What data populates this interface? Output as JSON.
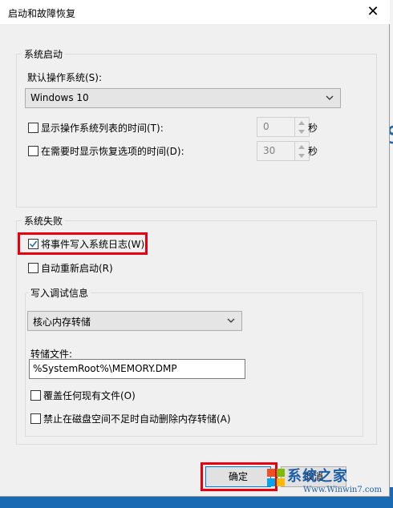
{
  "window": {
    "title": "启动和故障恢复",
    "close_glyph": "✕"
  },
  "system_startup": {
    "legend": "系统启动",
    "default_os_label": "默认操作系统(S):",
    "default_os_value": "Windows 10",
    "show_os_list": {
      "label": "显示操作系统列表的时间(T):",
      "checked": false,
      "value": "0",
      "unit": "秒"
    },
    "show_recovery": {
      "label": "在需要时显示恢复选项的时间(D):",
      "checked": false,
      "value": "30",
      "unit": "秒"
    }
  },
  "system_failure": {
    "legend": "系统失败",
    "write_event": {
      "label": "将事件写入系统日志(W)",
      "checked": true
    },
    "auto_restart": {
      "label": "自动重新启动(R)",
      "checked": false
    },
    "debug_info": {
      "legend": "写入调试信息",
      "type_value": "核心内存转储",
      "dump_file_label": "转储文件:",
      "dump_file_value": "%SystemRoot%\\MEMORY.DMP",
      "overwrite": {
        "label": "覆盖任何现有文件(O)",
        "checked": false
      },
      "disable_auto_delete": {
        "label": "禁止在磁盘空间不足时自动删除内存转储(A)",
        "checked": false
      }
    }
  },
  "buttons": {
    "ok": "确定",
    "cancel": "取消"
  },
  "watermark": {
    "main": "系统之家",
    "sub": "Www.Winwin7.com"
  },
  "colors": {
    "accent": "#0078d7",
    "highlight": "#e60012",
    "checkmark": "#1a6ab3"
  }
}
